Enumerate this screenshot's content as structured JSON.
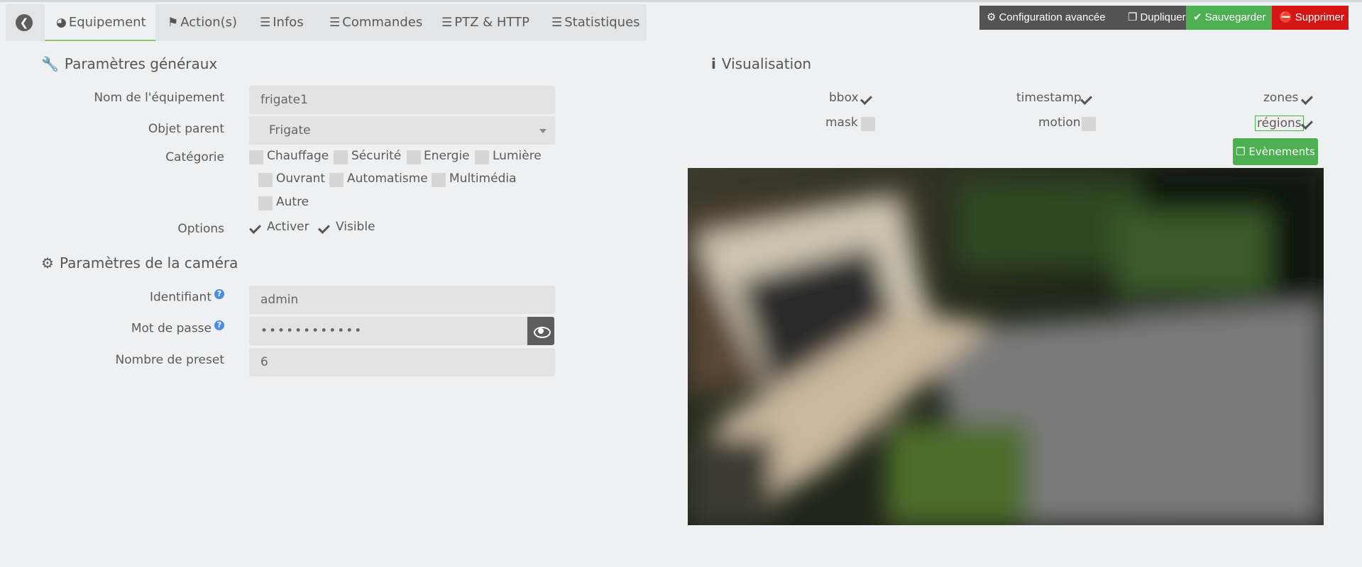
{
  "tabs": [
    {
      "label": "Equipement",
      "icon": "tachometer-icon"
    },
    {
      "label": "Action(s)",
      "icon": "flag-icon"
    },
    {
      "label": "Infos",
      "icon": "list-icon"
    },
    {
      "label": "Commandes",
      "icon": "list-icon"
    },
    {
      "label": "PTZ & HTTP",
      "icon": "list-icon"
    },
    {
      "label": "Statistiques",
      "icon": "list-icon"
    }
  ],
  "actions": {
    "config": "Configuration avancée",
    "duplicate": "Dupliquer",
    "save": "Sauvegarder",
    "delete": "Supprimer"
  },
  "general": {
    "title": "Paramètres généraux",
    "name_label": "Nom de l'équipement",
    "name_value": "frigate1",
    "parent_label": "Objet parent",
    "parent_value": "Frigate",
    "category_label": "Catégorie",
    "categories": [
      "Chauffage",
      "Sécurité",
      "Energie",
      "Lumière",
      "Ouvrant",
      "Automatisme",
      "Multimédia",
      "Autre"
    ],
    "options_label": "Options",
    "options": [
      {
        "label": "Activer",
        "checked": true
      },
      {
        "label": "Visible",
        "checked": true
      }
    ]
  },
  "camera": {
    "title": "Paramètres de la caméra",
    "id_label": "Identifiant",
    "id_value": "admin",
    "password_label": "Mot de passe",
    "password_value": "••••••••••••",
    "preset_label": "Nombre de preset",
    "preset_value": "6",
    "help_glyph": "?"
  },
  "visualisation": {
    "title": "Visualisation",
    "items": [
      {
        "label": "bbox",
        "checked": true
      },
      {
        "label": "timestamp",
        "checked": true
      },
      {
        "label": "zones",
        "checked": true
      },
      {
        "label": "mask",
        "checked": false
      },
      {
        "label": "motion",
        "checked": false
      },
      {
        "label": "régions",
        "checked": true
      }
    ],
    "events_button": "Evènements"
  },
  "colors": {
    "green": "#4caf50",
    "red": "#d51515",
    "dark": "#535353",
    "tab_active_border": "#8fc26b"
  }
}
